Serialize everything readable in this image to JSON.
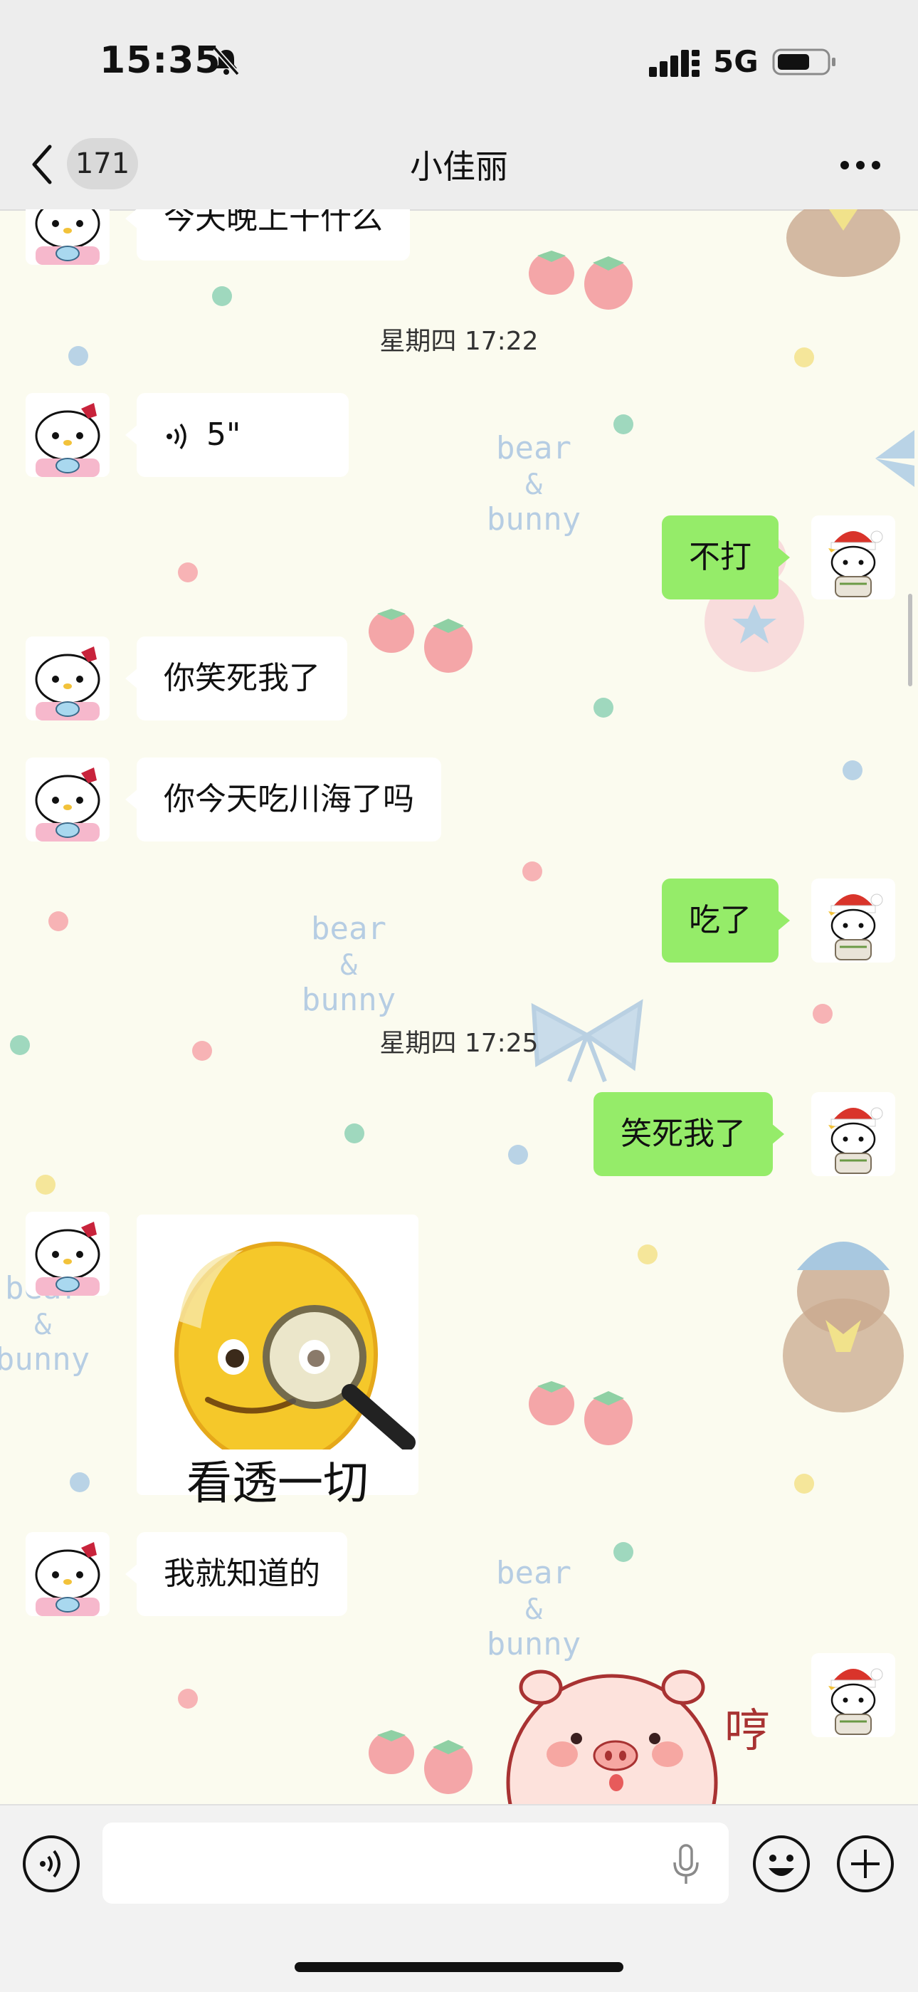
{
  "status_bar": {
    "time": "15:35",
    "network": "5G"
  },
  "header": {
    "unread_count": "171",
    "title": "小佳丽"
  },
  "messages": [
    {
      "type": "text",
      "from": "them",
      "text": "今天晚上干什么"
    },
    {
      "type": "timestamp",
      "text": "星期四 17:22"
    },
    {
      "type": "voice",
      "from": "them",
      "duration": "5\""
    },
    {
      "type": "text",
      "from": "me",
      "text": "不打"
    },
    {
      "type": "text",
      "from": "them",
      "text": "你笑死我了"
    },
    {
      "type": "text",
      "from": "them",
      "text": "你今天吃川海了吗"
    },
    {
      "type": "text",
      "from": "me",
      "text": "吃了"
    },
    {
      "type": "timestamp",
      "text": "星期四 17:25"
    },
    {
      "type": "text",
      "from": "me",
      "text": "笑死我了"
    },
    {
      "type": "sticker",
      "from": "them",
      "caption": "看透一切",
      "emoji": "older-man-magnifier"
    },
    {
      "type": "text",
      "from": "them",
      "text": "我就知道的"
    },
    {
      "type": "sticker",
      "from": "me",
      "caption": "哼",
      "emoji": "pink-pig"
    }
  ],
  "wallpaper": {
    "text_lines": [
      "bear",
      "&",
      "bunny"
    ]
  },
  "colors": {
    "out_bubble": "#95ec69",
    "in_bubble": "#ffffff",
    "header_bg": "#ededed",
    "chat_bg": "#fbfbef"
  }
}
